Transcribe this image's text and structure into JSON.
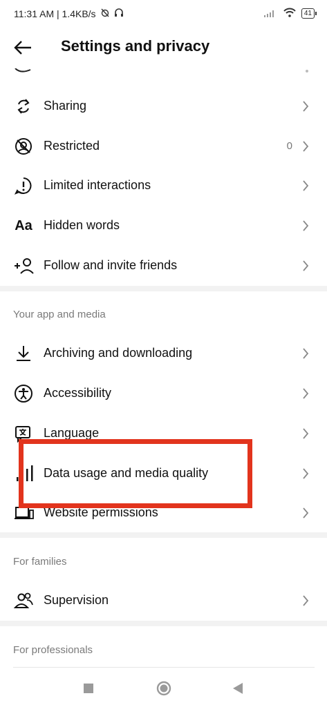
{
  "status": {
    "time_speed": "11:31 AM | 1.4KB/s",
    "battery": "41"
  },
  "header": {
    "title": "Settings and privacy"
  },
  "rows_top": [
    {
      "label": "Sharing",
      "icon": "sharing-icon",
      "value": ""
    },
    {
      "label": "Restricted",
      "icon": "restricted-icon",
      "value": "0"
    },
    {
      "label": "Limited interactions",
      "icon": "limited-interactions-icon",
      "value": ""
    },
    {
      "label": "Hidden words",
      "icon": "hidden-words-icon",
      "value": ""
    },
    {
      "label": "Follow and invite friends",
      "icon": "follow-invite-icon",
      "value": ""
    }
  ],
  "section_app_media": {
    "label": "Your app and media",
    "items": [
      {
        "label": "Archiving and downloading",
        "icon": "download-icon"
      },
      {
        "label": "Accessibility",
        "icon": "accessibility-icon"
      },
      {
        "label": "Language",
        "icon": "language-icon"
      },
      {
        "label": "Data usage and media quality",
        "icon": "data-usage-icon"
      },
      {
        "label": "Website permissions",
        "icon": "website-permissions-icon"
      }
    ]
  },
  "section_families": {
    "label": "For families",
    "items": [
      {
        "label": "Supervision",
        "icon": "supervision-icon"
      }
    ]
  },
  "section_professionals": {
    "label": "For professionals"
  },
  "highlight_color": "#e2341d"
}
